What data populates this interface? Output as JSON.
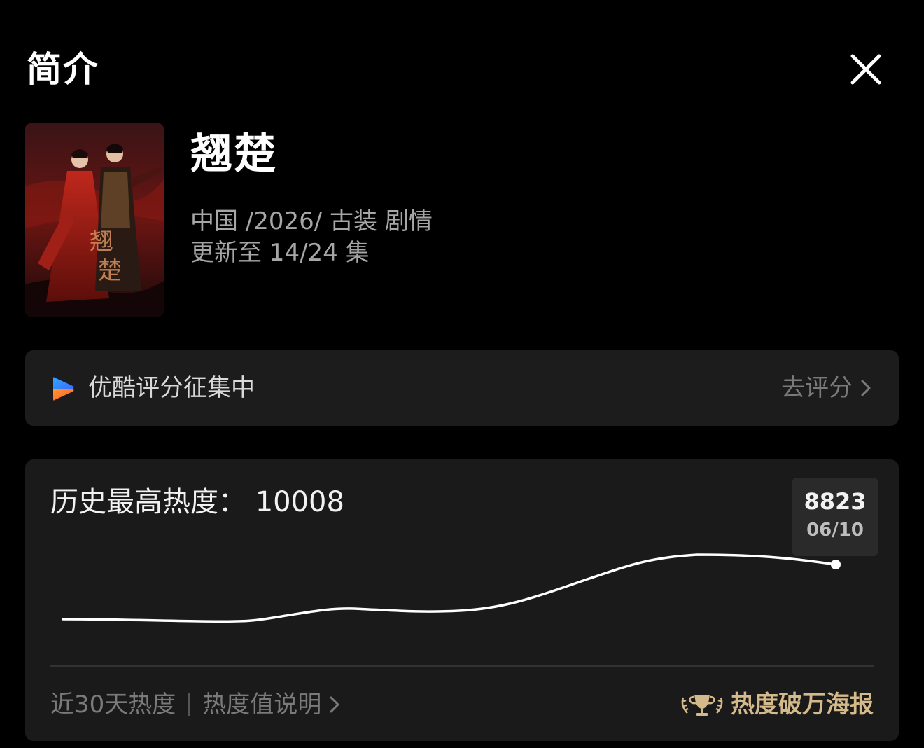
{
  "header": {
    "title": "简介",
    "close_icon": "close-icon"
  },
  "show": {
    "title": "翘楚",
    "meta_line": "中国 /2026/ 古装 剧情",
    "episodes": "更新至 14/24 集"
  },
  "rating": {
    "label": "优酷评分征集中",
    "action": "去评分",
    "logo_icon": "youku-logo-icon"
  },
  "heat": {
    "title": "历史最高热度： 10008",
    "tooltip": {
      "value": "8823",
      "date": "06/10"
    },
    "footer_left": "近30天热度",
    "footer_link": "热度值说明",
    "poster_link": "热度破万海报",
    "accent_color": "#d4b98a"
  }
}
